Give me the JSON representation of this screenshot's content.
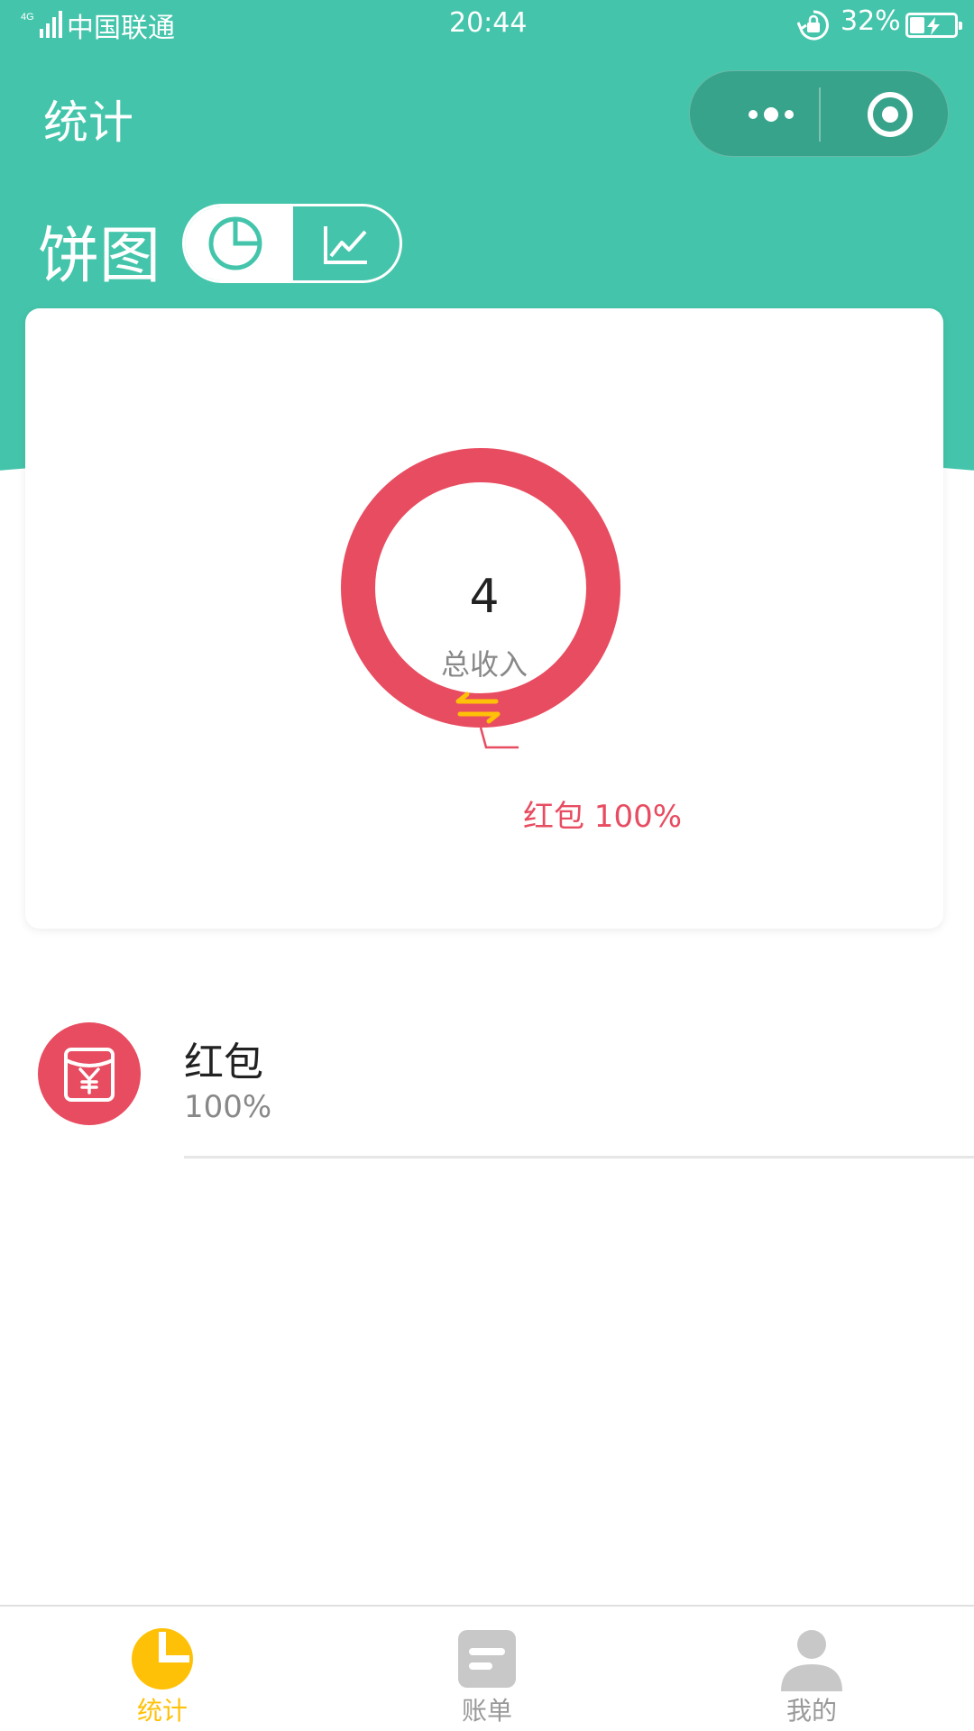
{
  "status_bar": {
    "network": "4G",
    "carrier": "中国联通",
    "time": "20:44",
    "battery_percent": "32%",
    "battery_level": 0.32
  },
  "nav": {
    "title": "统计",
    "more_icon": "more-dots-icon",
    "close_icon": "record-target-icon"
  },
  "switcher": {
    "section_title": "饼图",
    "options": [
      {
        "icon": "pie-chart-icon",
        "selected": true
      },
      {
        "icon": "line-chart-icon",
        "selected": false
      }
    ]
  },
  "colors": {
    "header": "#44c5ab",
    "capsule": "#37a38b",
    "slice": "#e84c60",
    "accent": "#ffc107",
    "inactive_tab": "#999999"
  },
  "chart_data": {
    "type": "pie",
    "variant": "donut",
    "center_value": "4",
    "center_label": "总收入",
    "toggle_icon": "swap-arrows-icon",
    "series": [
      {
        "name": "红包",
        "value": 4,
        "percent": 100,
        "label": "红包 100%"
      }
    ]
  },
  "categories": [
    {
      "name": "红包",
      "percent": "100%",
      "icon": "red-envelope-yen-icon"
    }
  ],
  "tabs": [
    {
      "label": "统计",
      "icon": "pie-chart-icon",
      "active": true
    },
    {
      "label": "账单",
      "icon": "bill-icon",
      "active": false
    },
    {
      "label": "我的",
      "icon": "user-icon",
      "active": false
    }
  ]
}
